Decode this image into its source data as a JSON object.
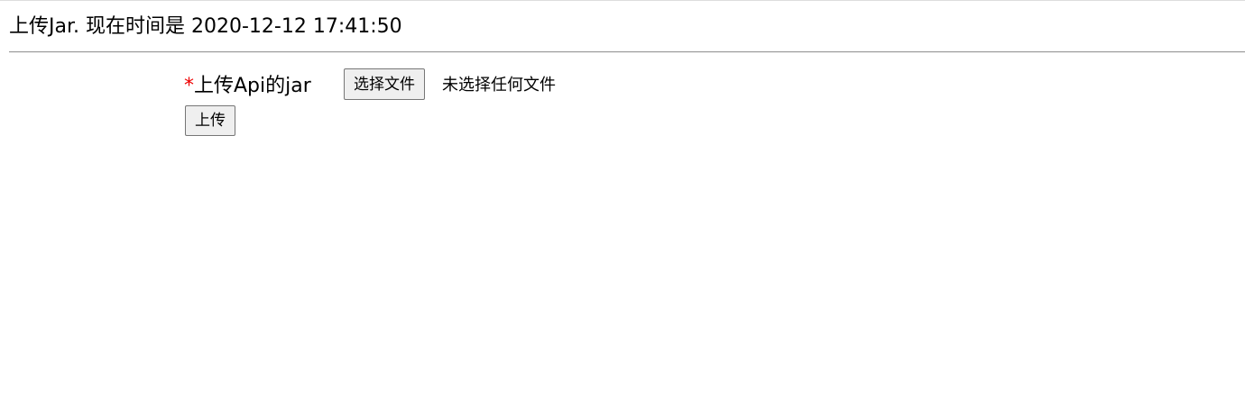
{
  "header": {
    "title": "上传Jar. 现在时间是 2020-12-12 17:41:50"
  },
  "form": {
    "required_mark": "*",
    "jar_label": "上传Api的jar",
    "choose_file_label": "选择文件",
    "no_file_text": "未选择任何文件",
    "upload_label": "上传"
  },
  "colors": {
    "required": "#ee0000"
  }
}
